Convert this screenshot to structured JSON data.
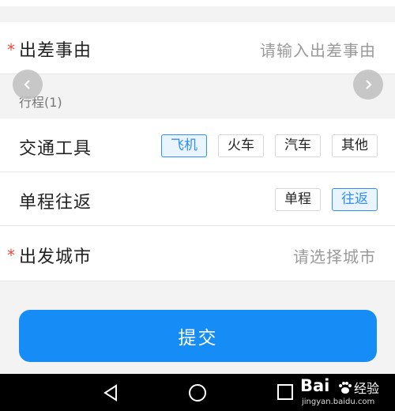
{
  "form": {
    "reason": {
      "required_mark": "*",
      "label": "出差事由",
      "placeholder": "请输入出差事由"
    },
    "itinerary_section_label": "行程(1)",
    "transport": {
      "label": "交通工具",
      "options": [
        "飞机",
        "火车",
        "汽车",
        "其他"
      ],
      "selected": "飞机"
    },
    "trip_type": {
      "label": "单程往返",
      "options": [
        "单程",
        "往返"
      ],
      "selected": "往返"
    },
    "departure_city": {
      "required_mark": "*",
      "label": "出发城市",
      "placeholder": "请选择城市"
    },
    "submit_label": "提交"
  },
  "carousel": {
    "prev_icon": "chevron-left-icon",
    "next_icon": "chevron-right-icon"
  },
  "nav_bar": {
    "back_icon": "triangle-back-icon",
    "home_icon": "circle-home-icon",
    "recents_icon": "square-recents-icon"
  },
  "watermark": {
    "logo": "Bai",
    "logo_suffix": "经验",
    "url": "jingyan.baidu.com"
  },
  "colors": {
    "accent": "#168cf6",
    "chip_selected": "#2f8ff2",
    "required": "#f0483e",
    "placeholder": "#9a9a9a"
  }
}
